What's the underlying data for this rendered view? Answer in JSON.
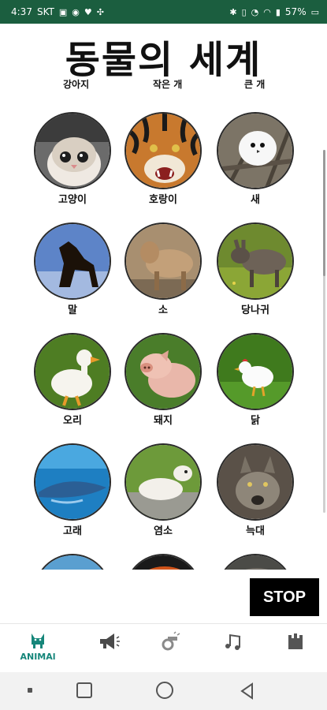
{
  "status_bar": {
    "time": "4:37",
    "carrier": "SKT",
    "battery": "57%"
  },
  "app": {
    "title": "동물의 세계"
  },
  "tabs": [
    "강아지",
    "작은 개",
    "큰 개"
  ],
  "animals": [
    {
      "label": "고양이",
      "icon": "cat-photo"
    },
    {
      "label": "호랑이",
      "icon": "tiger-photo"
    },
    {
      "label": "새",
      "icon": "bird-photo"
    },
    {
      "label": "말",
      "icon": "horse-photo"
    },
    {
      "label": "소",
      "icon": "cow-photo"
    },
    {
      "label": "당나귀",
      "icon": "donkey-photo"
    },
    {
      "label": "오리",
      "icon": "duck-photo"
    },
    {
      "label": "돼지",
      "icon": "pig-photo"
    },
    {
      "label": "닭",
      "icon": "chicken-photo"
    },
    {
      "label": "고래",
      "icon": "whale-photo"
    },
    {
      "label": "염소",
      "icon": "goat-photo"
    },
    {
      "label": "늑대",
      "icon": "wolf-photo"
    }
  ],
  "stop_button": {
    "label": "STOP"
  },
  "bottom_nav": [
    {
      "label": "ANIMAl",
      "icon": "cat-icon"
    },
    {
      "label": "",
      "icon": "megaphone-icon"
    },
    {
      "label": "",
      "icon": "whistle-icon"
    },
    {
      "label": "",
      "icon": "music-notes-icon"
    },
    {
      "label": "",
      "icon": "building-icon"
    }
  ],
  "colors": {
    "status_bar": "#1b5e3f",
    "accent": "#16867a",
    "stop_bg": "#000000"
  }
}
